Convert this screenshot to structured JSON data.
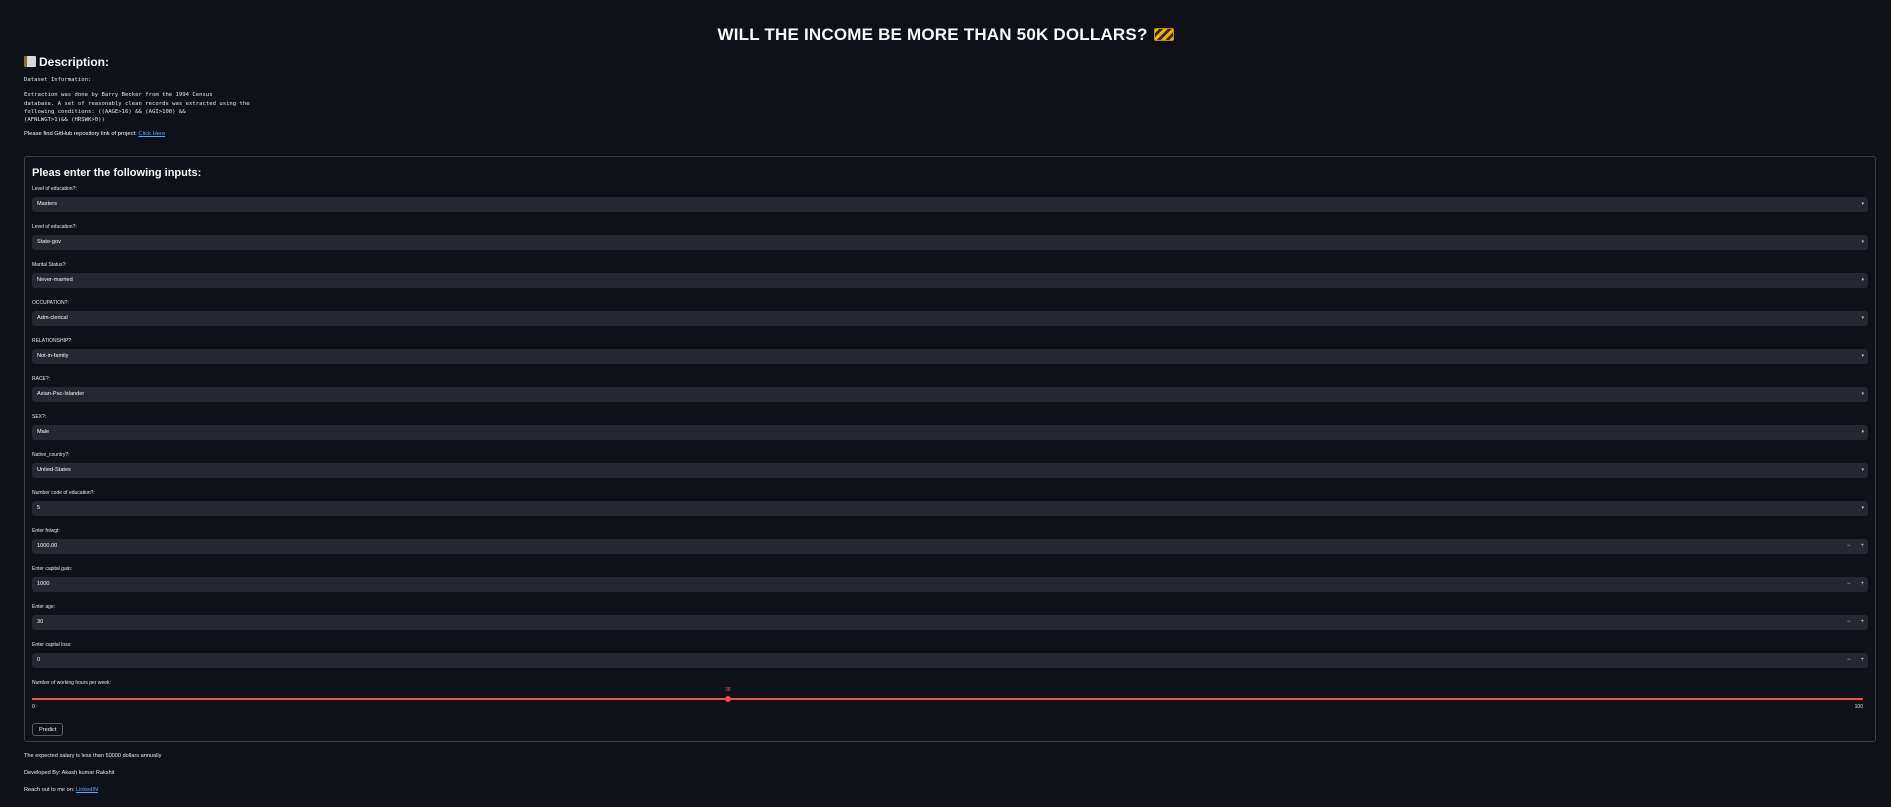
{
  "header": {
    "title": "WILL THE INCOME BE MORE THAN 50K DOLLARS?",
    "title_icon": "construction-barrier-icon"
  },
  "description": {
    "heading": "Description:",
    "heading_icon": "ledger-book-icon",
    "dataset_info": "Dataset Information:",
    "body_lines": [
      "Extraction was done by Barry Becker from the 1994 Census",
      "database. A set of reasonably clean records was extracted using the",
      "following conditions: ((AAGE>16) && (AGI>100) &&",
      "(AFNLWGT>1)&& (HRSWK>0))"
    ],
    "repo_text": "Please find GitHub repository link of project:",
    "repo_link": "Click Here"
  },
  "form": {
    "title": "Pleas enter the following inputs:",
    "selects": [
      {
        "label": "Level of education?:",
        "value": "Masters"
      },
      {
        "label": "Level of education?:",
        "value": "State-gov"
      },
      {
        "label": "Marital Status?:",
        "value": "Never-married"
      },
      {
        "label": "OCCUPATION?:",
        "value": "Adm-clerical"
      },
      {
        "label": "RELATIONSHIP?:",
        "value": "Not-in-family"
      },
      {
        "label": "RACE?:",
        "value": "Asian-Pac-Islander"
      },
      {
        "label": "SEX?:",
        "value": "Male"
      },
      {
        "label": "Native_country?:",
        "value": "United-States"
      },
      {
        "label": "Number code of education?:",
        "value": "5"
      }
    ],
    "numbers": [
      {
        "label": "Enter fnlwgt:",
        "value": "1000.00"
      },
      {
        "label": "Enter capital gain:",
        "value": "1000"
      },
      {
        "label": "Enter age:",
        "value": "30"
      },
      {
        "label": "Enter capital loss:",
        "value": "0"
      }
    ],
    "stepper_minus": "−",
    "stepper_plus": "+",
    "caret": "▾",
    "slider": {
      "label": "Number of working hours per week:",
      "value": 38,
      "value_label": "38",
      "min": 0,
      "max": 100,
      "min_label": "0",
      "max_label": "100",
      "color": "#ff4b4b"
    },
    "predict_label": "Predict"
  },
  "footer": {
    "result": "The expected salary is less than 50000 dollars annually",
    "developer": "Developed By: Akash kumar Rakshit",
    "reach_text": "Reach out to me on:",
    "reach_link": "LinkedIN"
  },
  "colors": {
    "background": "#0e1117",
    "input_bg": "#262730",
    "accent": "#ff4b4b",
    "link": "#58a6ff"
  }
}
